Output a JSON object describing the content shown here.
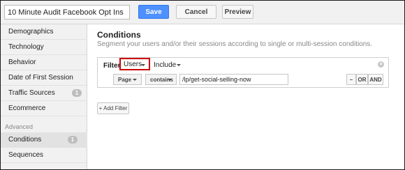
{
  "header": {
    "segment_name": "10 Minute Audit Facebook Opt Ins",
    "save_label": "Save",
    "cancel_label": "Cancel",
    "preview_label": "Preview"
  },
  "sidebar": {
    "items": [
      {
        "label": "Demographics"
      },
      {
        "label": "Technology"
      },
      {
        "label": "Behavior"
      },
      {
        "label": "Date of First Session"
      },
      {
        "label": "Traffic Sources",
        "badge": "1"
      },
      {
        "label": "Ecommerce"
      }
    ],
    "advanced_label": "Advanced",
    "advanced_items": [
      {
        "label": "Conditions",
        "badge": "1",
        "selected": true
      },
      {
        "label": "Sequences"
      }
    ]
  },
  "main": {
    "title": "Conditions",
    "description": "Segment your users and/or their sessions according to single or multi-session conditions.",
    "filter": {
      "label": "Filter",
      "scope_value": "Users",
      "include_value": "Include",
      "remove_icon": "×",
      "dimension": "Page",
      "operator": "contains",
      "value": "/lp/get-social-selling-now",
      "minus_label": "–",
      "or_label": "OR",
      "and_label": "AND"
    },
    "add_filter_label": "+ Add Filter"
  },
  "colors": {
    "accent": "#4d90fe",
    "highlight_border": "#cc0000",
    "sidebar_bg": "#f1f1f1",
    "selected_bg": "#e2e2e2"
  }
}
